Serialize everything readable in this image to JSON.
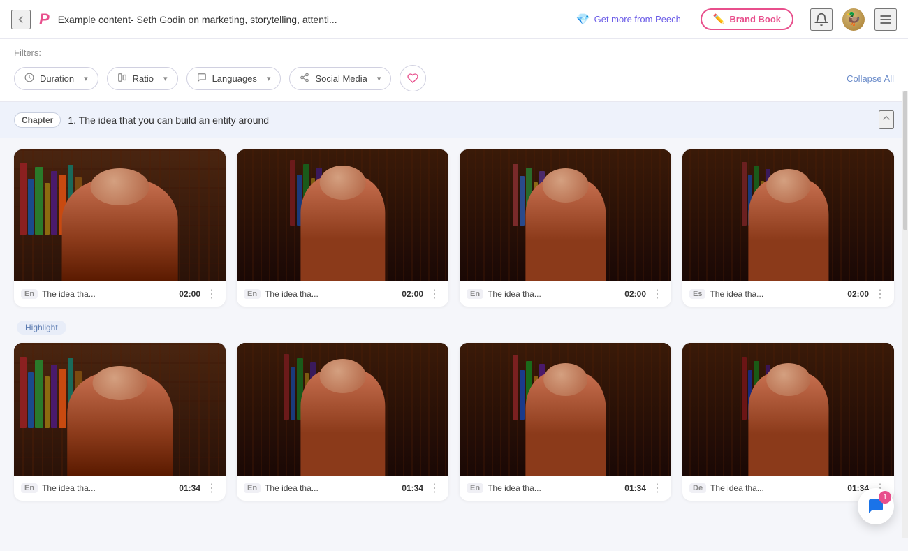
{
  "header": {
    "back_icon": "‹",
    "logo": "P",
    "title": "Example content- Seth Godin on marketing, storytelling, attenti...",
    "promo_text": "Get more from Peech",
    "brand_book_label": "Brand Book",
    "notification_icon": "🔔",
    "menu_icon": "☰"
  },
  "filters": {
    "label": "Filters:",
    "duration_label": "Duration",
    "ratio_label": "Ratio",
    "languages_label": "Languages",
    "social_media_label": "Social Media",
    "collapse_all_label": "Collapse All"
  },
  "chapter": {
    "badge": "Chapter",
    "title": "1. The idea that you can build an entity around"
  },
  "highlight": {
    "badge": "Highlight"
  },
  "cards_row1": [
    {
      "lang": "En",
      "name": "The idea tha...",
      "duration": "02:00"
    },
    {
      "lang": "En",
      "name": "The idea tha...",
      "duration": "02:00"
    },
    {
      "lang": "En",
      "name": "The idea tha...",
      "duration": "02:00"
    },
    {
      "lang": "Es",
      "name": "The idea tha...",
      "duration": "02:00"
    }
  ],
  "cards_row2": [
    {
      "lang": "En",
      "name": "The idea tha...",
      "duration": "01:34"
    },
    {
      "lang": "En",
      "name": "The idea tha...",
      "duration": "01:34"
    },
    {
      "lang": "En",
      "name": "The idea tha...",
      "duration": "01:34"
    },
    {
      "lang": "De",
      "name": "The idea tha...",
      "duration": "01:34"
    }
  ],
  "chat": {
    "badge": "1"
  }
}
